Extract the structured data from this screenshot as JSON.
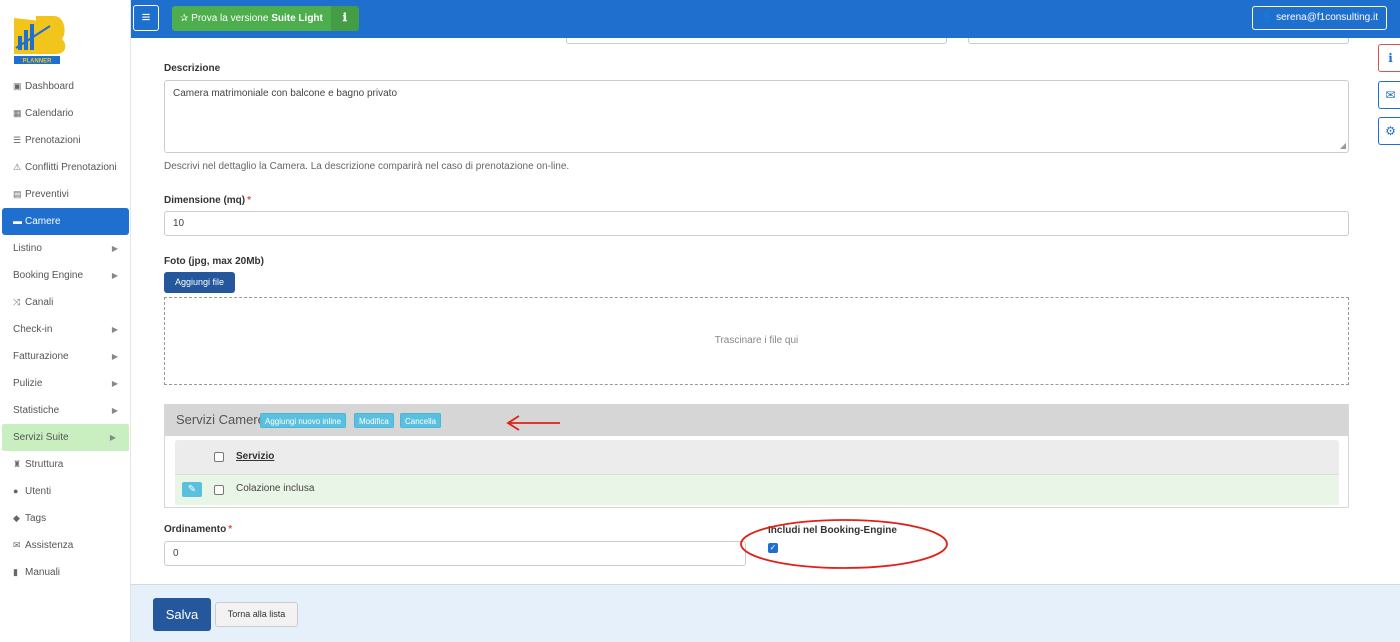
{
  "sidebar": {
    "logo_text": "PLANNER",
    "items": [
      {
        "label": "Dashboard",
        "icon": "dashboard-icon",
        "glyph": "▣"
      },
      {
        "label": "Calendario",
        "icon": "calendar-icon",
        "glyph": "▦"
      },
      {
        "label": "Prenotazioni",
        "icon": "list-icon",
        "glyph": "☰"
      },
      {
        "label": "Conflitti Prenotazioni",
        "icon": "warning-icon",
        "glyph": "⚠"
      },
      {
        "label": "Preventivi",
        "icon": "calculator-icon",
        "glyph": "▤"
      },
      {
        "label": "Camere",
        "icon": "bed-icon",
        "glyph": "▬"
      },
      {
        "label": "Listino",
        "chevron": "▶"
      },
      {
        "label": "Booking Engine",
        "chevron": "▶"
      },
      {
        "label": "Canali",
        "icon": "shuffle-icon",
        "glyph": "⤨"
      },
      {
        "label": "Check-in",
        "chevron": "▶"
      },
      {
        "label": "Fatturazione",
        "chevron": "▶"
      },
      {
        "label": "Pulizie",
        "chevron": "▶"
      },
      {
        "label": "Statistiche",
        "chevron": "▶"
      },
      {
        "label": "Servizi Suite",
        "chevron": "▶"
      },
      {
        "label": "Struttura",
        "icon": "tower-icon",
        "glyph": "♜"
      },
      {
        "label": "Utenti",
        "icon": "user-icon",
        "glyph": "●"
      },
      {
        "label": "Tags",
        "icon": "tags-icon",
        "glyph": "◆"
      },
      {
        "label": "Assistenza",
        "icon": "envelope-icon",
        "glyph": "✉"
      },
      {
        "label": "Manuali",
        "icon": "book-icon",
        "glyph": "▮"
      }
    ]
  },
  "topbar": {
    "menu_glyph": "≡",
    "promo_prefix": "✰ Prova la versione ",
    "promo_bold": "Suite Light",
    "promo_info_glyph": "ℹ",
    "user": "👤 serena@f1consulting.it"
  },
  "form": {
    "descrizione_label": "Descrizione",
    "descrizione_value": "Camera matrimoniale con balcone e bagno privato",
    "descrizione_help": "Descrivi nel dettaglio la Camera. La descrizione comparirà nel caso di prenotazione on-line.",
    "dimensione_label": "Dimensione (mq)",
    "required_mark": "*",
    "dimensione_value": "10",
    "foto_label": "Foto (jpg, max 20Mb)",
    "aggiungi_file": "Aggiungi file",
    "dropzone_text": "Trascinare i file qui",
    "ordinamento_label": "Ordinamento",
    "ordinamento_value": "0",
    "booking_label": "Includi nel Booking-Engine",
    "booking_checked": true,
    "check_glyph": "✓"
  },
  "servizi": {
    "title": "Servizi Camere",
    "btn_add": "Aggiungi nuovo inline",
    "btn_edit": "Modifica",
    "btn_delete": "Cancella",
    "column": "Servizio",
    "edit_glyph": "✎",
    "rows": [
      {
        "name": "Colazione inclusa"
      }
    ]
  },
  "footer": {
    "save": "Salva",
    "back": "Torna alla lista"
  },
  "right_buttons": [
    {
      "icon": "info-icon",
      "glyph": "ℹ"
    },
    {
      "icon": "envelope-icon",
      "glyph": "✉"
    },
    {
      "icon": "gears-icon",
      "glyph": "⚙"
    }
  ],
  "colors": {
    "primary": "#1e6fce",
    "dark_primary": "#24579c",
    "promo_green": "#4cae4c",
    "info": "#5bc0de",
    "annotation_red": "#e0201a"
  }
}
